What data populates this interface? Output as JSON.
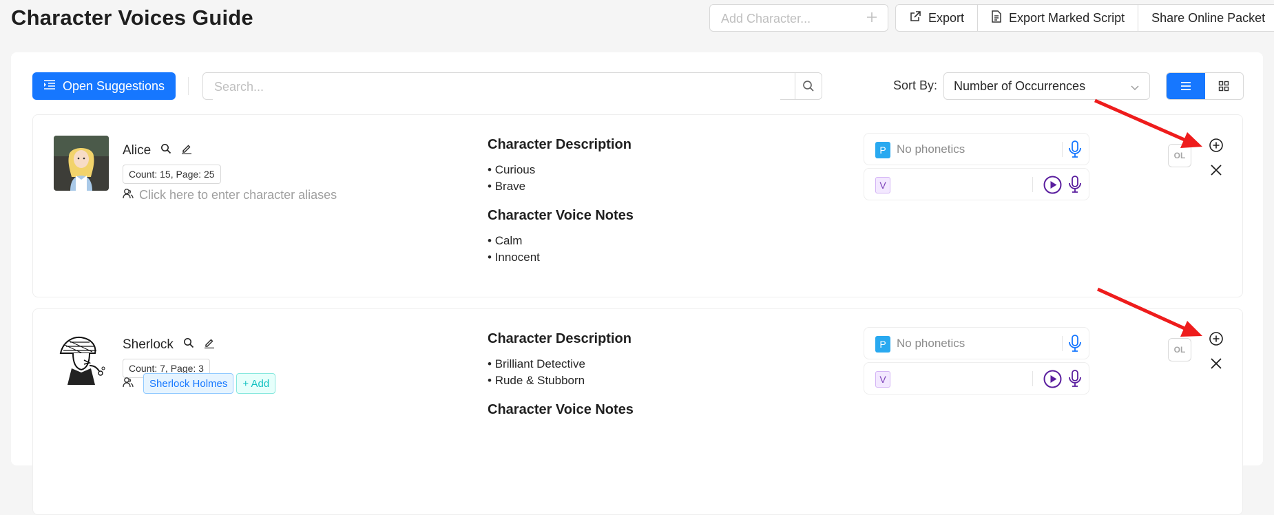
{
  "header": {
    "title": "Character Voices Guide",
    "add_placeholder": "Add Character...",
    "buttons": [
      {
        "label": "Export",
        "icon": "external-export-icon"
      },
      {
        "label": "Export Marked Script",
        "icon": "document-icon"
      },
      {
        "label": "Share Online Packet",
        "icon": ""
      }
    ]
  },
  "toolbar": {
    "open_suggestions": "Open Suggestions",
    "search_placeholder": "Search...",
    "sort_label": "Sort By:",
    "sort_value": "Number of Occurrences",
    "active_view": "list"
  },
  "characters": [
    {
      "name": "Alice",
      "count_text": "Count: 15, Page: 25",
      "aliases_placeholder": "Click here to enter character aliases",
      "aliases": [],
      "description_title": "Character Description",
      "description": [
        "Curious",
        "Brave"
      ],
      "voice_title": "Character Voice Notes",
      "voice_notes": [
        "Calm",
        "Innocent"
      ],
      "phonetics_tag": "P",
      "phonetics_placeholder": "No phonetics",
      "voice_tag": "V",
      "ol_label": "OL"
    },
    {
      "name": "Sherlock",
      "count_text": "Count: 7, Page: 3",
      "aliases": [
        "Sherlock Holmes"
      ],
      "add_alias_label": "+ Add",
      "description_title": "Character Description",
      "description": [
        "Brilliant Detective",
        "Rude & Stubborn"
      ],
      "voice_title": "Character Voice Notes",
      "voice_notes": [],
      "phonetics_tag": "P",
      "phonetics_placeholder": "No phonetics",
      "voice_tag": "V",
      "ol_label": "OL"
    }
  ],
  "colors": {
    "primary": "#1677ff",
    "annotation_arrow": "#ee1c1c",
    "play_purple": "#5a1e9e",
    "mic_blue": "#1677ff",
    "mic_purple": "#5a1e9e"
  }
}
